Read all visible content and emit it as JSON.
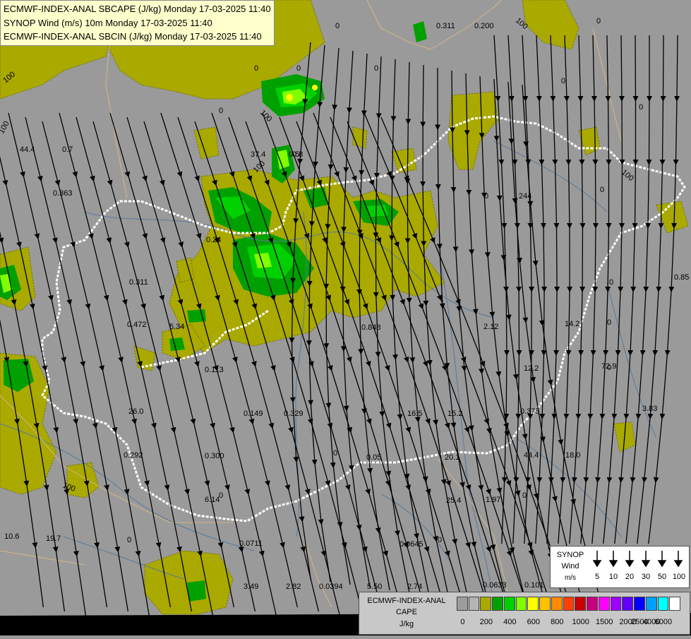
{
  "header": {
    "line1": "ECMWF-INDEX-ANAL SBCAPE (J/kg) Monday 17-03-2025 11:40",
    "line2": "SYNOP Wind (m/s) 10m Monday 17-03-2025 11:40",
    "line3": "ECMWF-INDEX-ANAL SBCIN (J/kg) Monday 17-03-2025 11:40"
  },
  "wind_legend": {
    "title1": "SYNOP",
    "title2": "Wind",
    "unit": "m/s",
    "speeds": [
      "5",
      "10",
      "20",
      "30",
      "50",
      "100"
    ]
  },
  "cape_legend": {
    "title1": "ECMWF-INDEX-ANAL",
    "title2": "CAPE",
    "unit": "J/kg",
    "ticks": [
      "0",
      "200",
      "400",
      "600",
      "800",
      "1000",
      "1500",
      "2000",
      "2500",
      "4000",
      "6000"
    ],
    "colors": [
      "#9c9c9c",
      "#b4b4b4",
      "#a9a900",
      "#00a000",
      "#00d000",
      "#80ff00",
      "#ffff00",
      "#ffc000",
      "#ff8c00",
      "#ff4000",
      "#c80000",
      "#c80080",
      "#ff00ff",
      "#a000ff",
      "#6000ff",
      "#0000ff",
      "#00a0ff",
      "#00ffff",
      "#ffffff"
    ]
  },
  "map": {
    "colors": {
      "background": "#9a9a9a",
      "cape_low": "#a9a900",
      "cape_green": "#00a000",
      "cape_bright": "#00d000",
      "cape_lime": "#80ff00",
      "border": "#ffffff",
      "rivers": "#5a7a9a",
      "streamlines": "#000000"
    },
    "cin_contour_labels": [
      "100",
      "100",
      "100",
      "100",
      "100",
      "100",
      "100"
    ],
    "cin_values": [
      {
        "text": "0"
      },
      {
        "text": "0"
      },
      {
        "text": "0"
      },
      {
        "text": "0"
      },
      {
        "text": "0"
      },
      {
        "text": "0"
      },
      {
        "text": "0.311"
      },
      {
        "text": "0.200"
      },
      {
        "text": "0"
      },
      {
        "text": "0"
      },
      {
        "text": "0"
      },
      {
        "text": "44.4"
      },
      {
        "text": "0.7"
      },
      {
        "text": "37.4"
      },
      {
        "text": "0.8"
      },
      {
        "text": "0.363"
      },
      {
        "text": "0.311"
      },
      {
        "text": "0.24"
      },
      {
        "text": "0.472"
      },
      {
        "text": "5.34"
      },
      {
        "text": "0.848"
      },
      {
        "text": "2.12"
      },
      {
        "text": "14.2"
      },
      {
        "text": "0.113"
      },
      {
        "text": "12.2"
      },
      {
        "text": "72.9"
      },
      {
        "text": "0.149"
      },
      {
        "text": "0.329"
      },
      {
        "text": "16.5"
      },
      {
        "text": "15.2"
      },
      {
        "text": "0.375"
      },
      {
        "text": "3.83"
      },
      {
        "text": "26.0"
      },
      {
        "text": "0.292"
      },
      {
        "text": "0.300"
      },
      {
        "text": "0.05"
      },
      {
        "text": "20.1"
      },
      {
        "text": "44.4"
      },
      {
        "text": "18.0"
      },
      {
        "text": "6.14"
      },
      {
        "text": "25.4"
      },
      {
        "text": "1.97"
      },
      {
        "text": "10.6"
      },
      {
        "text": "19.7"
      },
      {
        "text": "0.0711"
      },
      {
        "text": "0.0645"
      },
      {
        "text": "3.49"
      },
      {
        "text": "2.82"
      },
      {
        "text": "0.0394"
      },
      {
        "text": "5.50"
      },
      {
        "text": "2.74"
      },
      {
        "text": "0.0633"
      },
      {
        "text": "0.101"
      },
      {
        "text": "0.85"
      },
      {
        "text": "244"
      },
      {
        "text": "0.5"
      },
      {
        "text": "0"
      },
      {
        "text": "0"
      },
      {
        "text": "0"
      },
      {
        "text": "0"
      },
      {
        "text": "0"
      },
      {
        "text": "0"
      },
      {
        "text": "0"
      },
      {
        "text": "0"
      },
      {
        "text": "0"
      },
      {
        "text": "0"
      },
      {
        "text": "0"
      },
      {
        "text": "0"
      }
    ]
  }
}
